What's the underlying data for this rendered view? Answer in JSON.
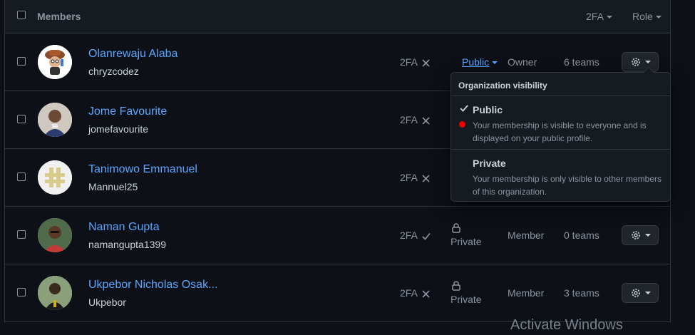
{
  "header": {
    "title": "Members",
    "filter_2fa": "2FA",
    "filter_role": "Role"
  },
  "members": [
    {
      "name": "Olanrewaju Alaba",
      "login": "chryzcodez",
      "twofa": "2FA",
      "twofa_status": "x-icon",
      "visibility": "Public",
      "role": "Owner",
      "teams": "6 teams"
    },
    {
      "name": "Jome Favourite",
      "login": "jomefavourite",
      "twofa": "2FA",
      "twofa_status": "x-icon"
    },
    {
      "name": "Tanimowo Emmanuel",
      "login": "Mannuel25",
      "twofa": "2FA",
      "twofa_status": "x-icon"
    },
    {
      "name": "Naman Gupta",
      "login": "namangupta1399",
      "twofa": "2FA",
      "twofa_status": "check-icon",
      "visibility": "Private",
      "role": "Member",
      "teams": "0 teams"
    },
    {
      "name": "Ukpebor Nicholas Osak...",
      "login": "Ukpebor",
      "twofa": "2FA",
      "twofa_status": "x-icon",
      "visibility": "Private",
      "role": "Member",
      "teams": "3 teams"
    }
  ],
  "dropdown": {
    "title": "Organization visibility",
    "options": [
      {
        "label": "Public",
        "description": "Your membership is visible to everyone and is displayed on your public profile.",
        "selected": true
      },
      {
        "label": "Private",
        "description": "Your membership is only visible to other members of this organization.",
        "selected": false
      }
    ]
  },
  "watermark": "Activate Windows",
  "colors": {
    "background": "#0d1117",
    "header": "#161b22",
    "border": "#30363d",
    "link": "#58a6ff",
    "muted": "#8b949e",
    "marker": "#f00000"
  }
}
